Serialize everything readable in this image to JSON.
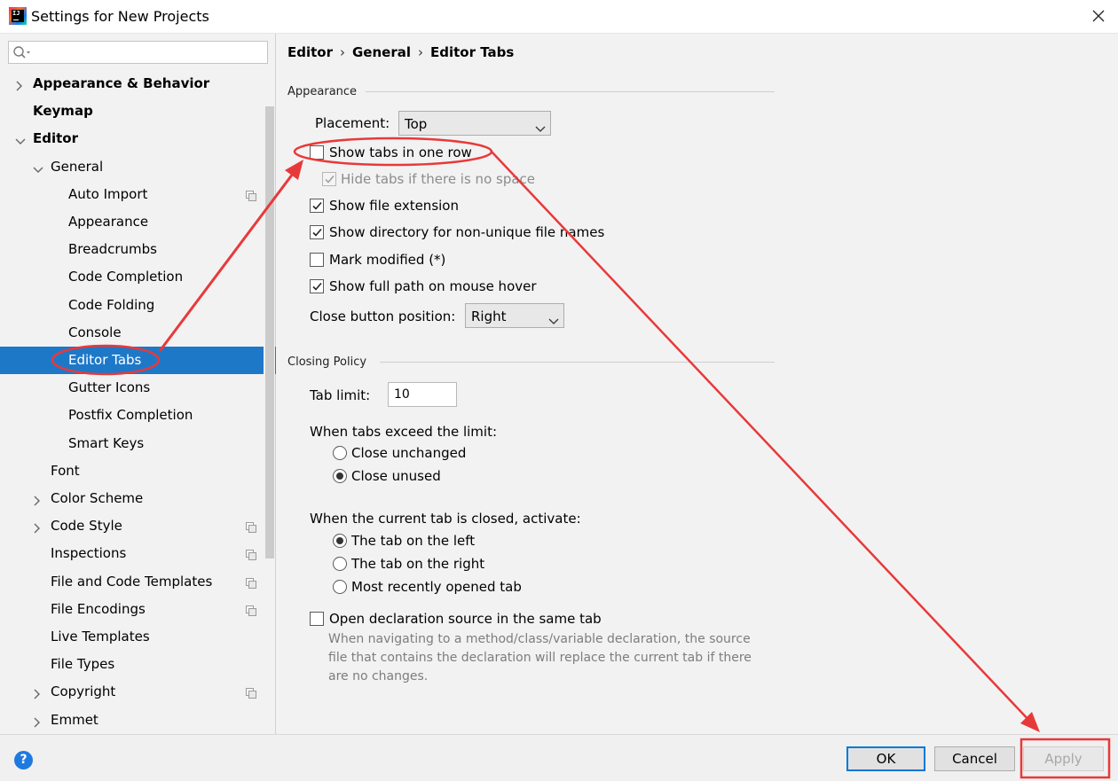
{
  "window": {
    "title": "Settings for New Projects",
    "app_icon": "intellij-idea-icon"
  },
  "sidebar": {
    "search": {
      "placeholder": "",
      "value": ""
    },
    "items": [
      {
        "label": "Appearance & Behavior",
        "bold": true,
        "expand": "collapsed",
        "indent": 0
      },
      {
        "label": "Keymap",
        "bold": true,
        "expand": "none",
        "indent": 0
      },
      {
        "label": "Editor",
        "bold": true,
        "expand": "expanded",
        "indent": 0
      },
      {
        "label": "General",
        "bold": false,
        "expand": "expanded",
        "indent": 1
      },
      {
        "label": "Auto Import",
        "bold": false,
        "expand": "none",
        "indent": 2,
        "copy_icon": true
      },
      {
        "label": "Appearance",
        "bold": false,
        "expand": "none",
        "indent": 2
      },
      {
        "label": "Breadcrumbs",
        "bold": false,
        "expand": "none",
        "indent": 2
      },
      {
        "label": "Code Completion",
        "bold": false,
        "expand": "none",
        "indent": 2
      },
      {
        "label": "Code Folding",
        "bold": false,
        "expand": "none",
        "indent": 2
      },
      {
        "label": "Console",
        "bold": false,
        "expand": "none",
        "indent": 2
      },
      {
        "label": "Editor Tabs",
        "bold": false,
        "expand": "none",
        "indent": 2,
        "selected": true
      },
      {
        "label": "Gutter Icons",
        "bold": false,
        "expand": "none",
        "indent": 2
      },
      {
        "label": "Postfix Completion",
        "bold": false,
        "expand": "none",
        "indent": 2
      },
      {
        "label": "Smart Keys",
        "bold": false,
        "expand": "none",
        "indent": 2
      },
      {
        "label": "Font",
        "bold": false,
        "expand": "none",
        "indent": 1
      },
      {
        "label": "Color Scheme",
        "bold": false,
        "expand": "collapsed",
        "indent": 1
      },
      {
        "label": "Code Style",
        "bold": false,
        "expand": "collapsed",
        "indent": 1,
        "copy_icon": true
      },
      {
        "label": "Inspections",
        "bold": false,
        "expand": "none",
        "indent": 1,
        "copy_icon": true
      },
      {
        "label": "File and Code Templates",
        "bold": false,
        "expand": "none",
        "indent": 1,
        "copy_icon": true
      },
      {
        "label": "File Encodings",
        "bold": false,
        "expand": "none",
        "indent": 1,
        "copy_icon": true
      },
      {
        "label": "Live Templates",
        "bold": false,
        "expand": "none",
        "indent": 1
      },
      {
        "label": "File Types",
        "bold": false,
        "expand": "none",
        "indent": 1
      },
      {
        "label": "Copyright",
        "bold": false,
        "expand": "collapsed",
        "indent": 1,
        "copy_icon": true
      },
      {
        "label": "Emmet",
        "bold": false,
        "expand": "collapsed",
        "indent": 1
      }
    ]
  },
  "breadcrumb": [
    "Editor",
    "General",
    "Editor Tabs"
  ],
  "appearance": {
    "title": "Appearance",
    "placement_label": "Placement:",
    "placement_value": "Top",
    "show_tabs_one_row": {
      "label": "Show tabs in one row",
      "checked": false
    },
    "hide_tabs_no_space": {
      "label": "Hide tabs if there is no space",
      "checked": true,
      "disabled": true
    },
    "show_file_extension": {
      "label": "Show file extension",
      "checked": true
    },
    "show_directory": {
      "label": "Show directory for non-unique file names",
      "checked": true
    },
    "mark_modified": {
      "label": "Mark modified (*)",
      "checked": false
    },
    "show_full_path": {
      "label": "Show full path on mouse hover",
      "checked": true
    },
    "close_button_label": "Close button position:",
    "close_button_value": "Right"
  },
  "closing": {
    "title": "Closing Policy",
    "tab_limit_label": "Tab limit:",
    "tab_limit_value": "10",
    "exceed_label": "When tabs exceed the limit:",
    "close_unchanged": "Close unchanged",
    "close_unused": "Close unused",
    "exceed_selected": "close_unused",
    "activate_label": "When the current tab is closed, activate:",
    "tab_left": "The tab on the left",
    "tab_right": "The tab on the right",
    "most_recent": "Most recently opened tab",
    "activate_selected": "tab_left",
    "open_decl": {
      "label": "Open declaration source in the same tab",
      "checked": false
    },
    "desc_lines": [
      "When navigating to a method/class/variable declaration, the source",
      "file that contains the declaration will replace the current tab if there",
      "are no changes."
    ]
  },
  "buttons": {
    "ok": "OK",
    "cancel": "Cancel",
    "apply": "Apply",
    "help": "?"
  },
  "colors": {
    "selection": "#1e78c8",
    "annotation_red": "#e8393a",
    "default_button_border": "#0078d7"
  }
}
